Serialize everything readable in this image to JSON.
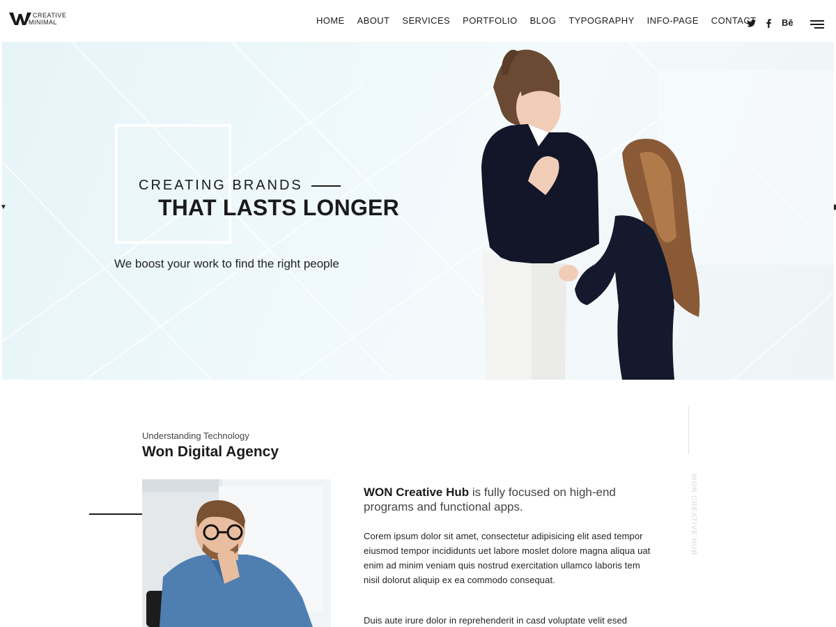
{
  "logo": {
    "line1": "CREATIVE",
    "line2": "MINIMAL"
  },
  "nav": [
    "HOME",
    "ABOUT",
    "SERVICES",
    "PORTFOLIO",
    "BLOG",
    "TYPOGRAPHY",
    "INFO-PAGE",
    "CONTACT"
  ],
  "social": {
    "twitter": "twitter-icon",
    "facebook": "facebook-icon",
    "behance": "Bē"
  },
  "hero": {
    "kicker": "CREATING BRANDS",
    "title": "THAT LASTS LONGER",
    "subtitle": "We boost your work to find the right people"
  },
  "about": {
    "eyebrow": "Understanding Technology",
    "title": "Won Digital Agency",
    "lead_bold": "WON Creative Hub",
    "lead_rest": " is fully focused on high-end programs and functional apps.",
    "paragraph1": "Corem ipsum dolor sit amet, consectetur adipisicing elit ased tempor eiusmod tempor incididunts uet labore moslet dolore magna aliqua uat enim ad minim veniam quis nostrud exercitation ullamco laboris tem nisil dolorut aliquip ex ea commodo consequat.",
    "paragraph2": "Duis aute irure dolor in reprehenderit in casd voluptate velit esed",
    "vertical_label": "WON CREATIVE HUB"
  },
  "colors": {
    "text": "#1a1a1a",
    "hero_bg": "#e6f4f8",
    "accent": "#ffffff"
  }
}
